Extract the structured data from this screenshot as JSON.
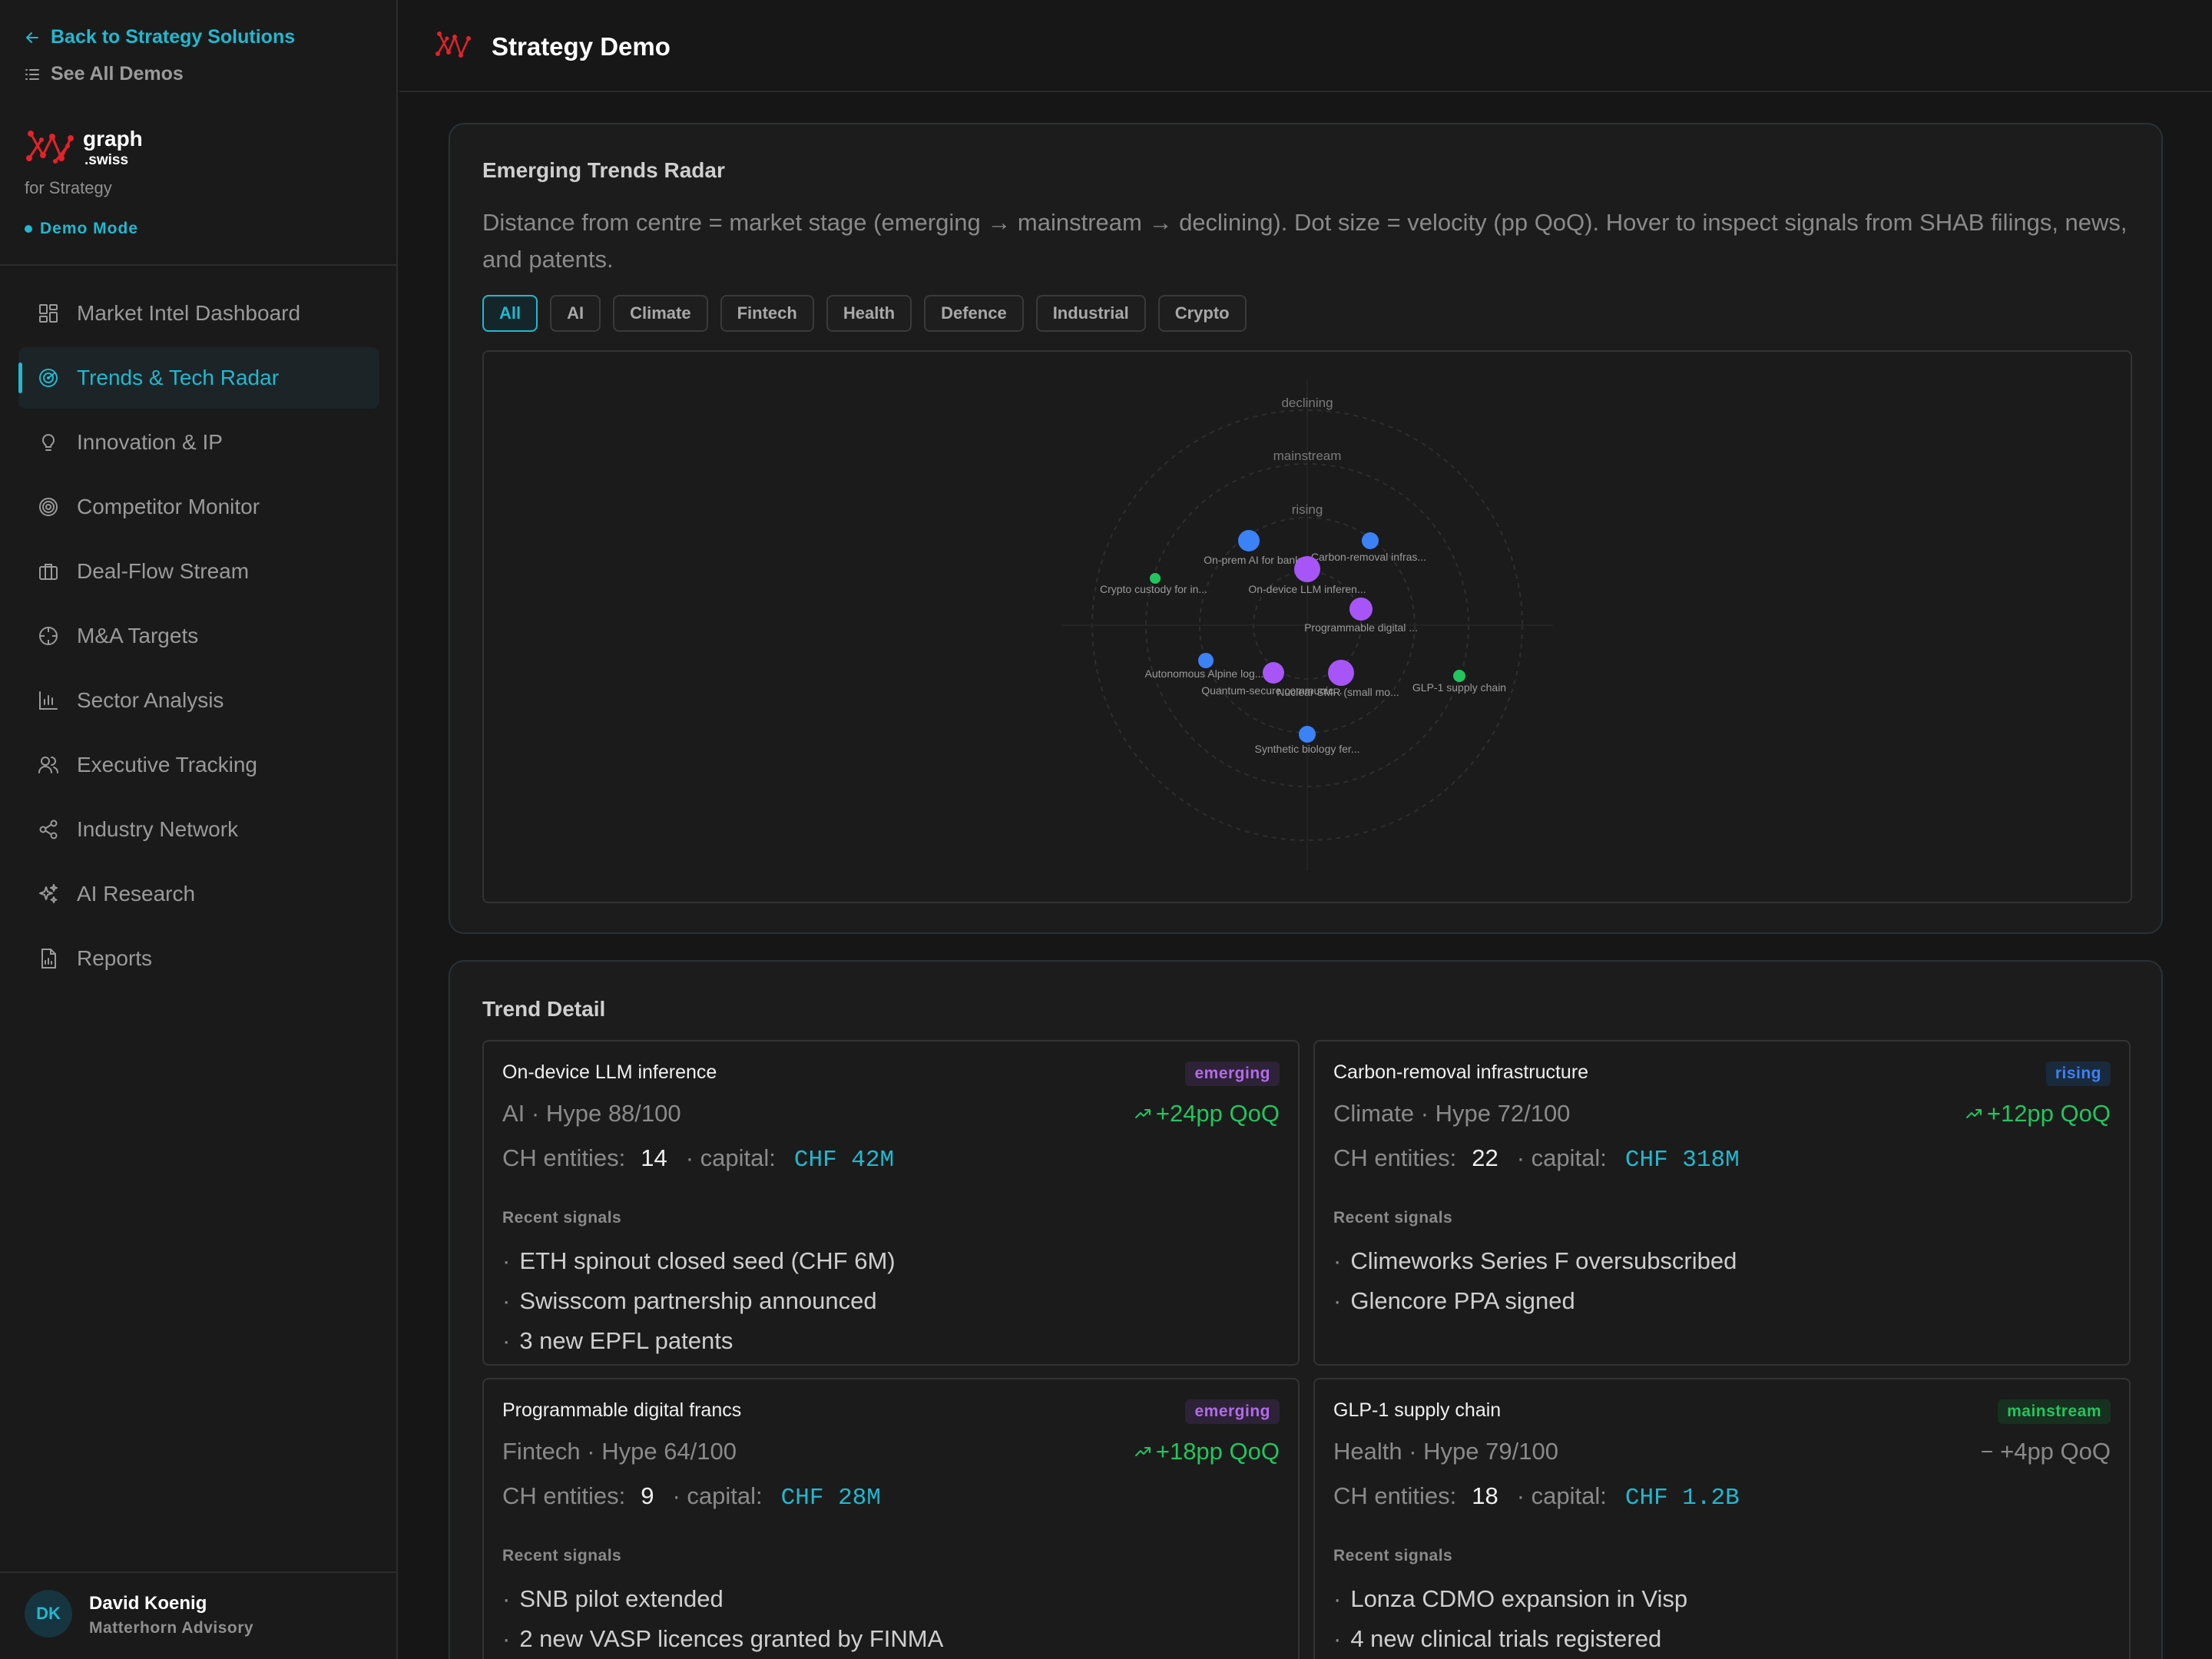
{
  "sidebar": {
    "back_label": "Back to Strategy Solutions",
    "see_all_label": "See All Demos",
    "brand": {
      "name": "graph",
      "suffix": ".swiss",
      "tagline": "for Strategy"
    },
    "demo_mode": "Demo Mode",
    "nav": [
      {
        "label": "Market Intel Dashboard",
        "icon": "dashboard-icon"
      },
      {
        "label": "Trends & Tech Radar",
        "icon": "radar-icon",
        "active": true
      },
      {
        "label": "Innovation & IP",
        "icon": "lightbulb-icon"
      },
      {
        "label": "Competitor Monitor",
        "icon": "target-icon"
      },
      {
        "label": "Deal-Flow Stream",
        "icon": "briefcase-icon"
      },
      {
        "label": "M&A Targets",
        "icon": "crosshair-icon"
      },
      {
        "label": "Sector Analysis",
        "icon": "bar-chart-icon"
      },
      {
        "label": "Executive Tracking",
        "icon": "users-icon"
      },
      {
        "label": "Industry Network",
        "icon": "share-network-icon"
      },
      {
        "label": "AI Research",
        "icon": "sparkles-icon"
      },
      {
        "label": "Reports",
        "icon": "report-icon"
      }
    ],
    "user": {
      "initials": "DK",
      "name": "David Koenig",
      "org": "Matterhorn Advisory"
    }
  },
  "header": {
    "title": "Strategy Demo"
  },
  "radar": {
    "title": "Emerging Trends Radar",
    "description": "Distance from centre = market stage (emerging → mainstream → declining). Dot size = velocity (pp QoQ). Hover to inspect signals from SHAB filings, news, and patents.",
    "filters": [
      "All",
      "AI",
      "Climate",
      "Fintech",
      "Health",
      "Defence",
      "Industrial",
      "Crypto"
    ],
    "active_filter": "All",
    "ring_labels": [
      "declining",
      "mainstream",
      "rising"
    ],
    "colors": {
      "emerging": "#a855f7",
      "rising": "#3b82f6",
      "mainstream": "#22c55e"
    },
    "points": [
      {
        "label": "On-prem AI for bank...",
        "stage": "rising"
      },
      {
        "label": "Carbon-removal infras...",
        "stage": "rising"
      },
      {
        "label": "On-device LLM inferen...",
        "stage": "emerging"
      },
      {
        "label": "Crypto custody for in...",
        "stage": "mainstream"
      },
      {
        "label": "Programmable digital ...",
        "stage": "emerging"
      },
      {
        "label": "Autonomous Alpine log...",
        "stage": "rising"
      },
      {
        "label": "Quantum-secure communic...",
        "stage": "emerging"
      },
      {
        "label": "Nuclear SMR (small mo...",
        "stage": "emerging"
      },
      {
        "label": "GLP-1 supply chain",
        "stage": "mainstream"
      },
      {
        "label": "Synthetic biology fer...",
        "stage": "rising"
      }
    ]
  },
  "detail": {
    "title": "Trend Detail",
    "entities_label": "CH entities:",
    "capital_label": "· capital:",
    "signals_label": "Recent signals",
    "cards": [
      {
        "name": "On-device LLM inference",
        "stage": "emerging",
        "meta": "AI  ·  Hype 88/100",
        "delta": "+24pp QoQ",
        "trend": "up",
        "entities": "14",
        "capital": "CHF 42M",
        "signals": [
          "ETH spinout closed seed (CHF 6M)",
          "Swisscom partnership announced",
          "3 new EPFL patents"
        ]
      },
      {
        "name": "Carbon-removal infrastructure",
        "stage": "rising",
        "meta": "Climate  ·  Hype 72/100",
        "delta": "+12pp QoQ",
        "trend": "up",
        "entities": "22",
        "capital": "CHF 318M",
        "signals": [
          "Climeworks Series F oversubscribed",
          "Glencore PPA signed"
        ]
      },
      {
        "name": "Programmable digital francs",
        "stage": "emerging",
        "meta": "Fintech  ·  Hype 64/100",
        "delta": "+18pp QoQ",
        "trend": "up",
        "entities": "9",
        "capital": "CHF 28M",
        "signals": [
          "SNB pilot extended",
          "2 new VASP licences granted by FINMA"
        ]
      },
      {
        "name": "GLP-1 supply chain",
        "stage": "mainstream",
        "meta": "Health  ·  Hype 79/100",
        "delta": "+4pp QoQ",
        "trend": "flat",
        "entities": "18",
        "capital": "CHF 1.2B",
        "signals": [
          "Lonza CDMO expansion in Visp",
          "4 new clinical trials registered"
        ]
      }
    ]
  }
}
